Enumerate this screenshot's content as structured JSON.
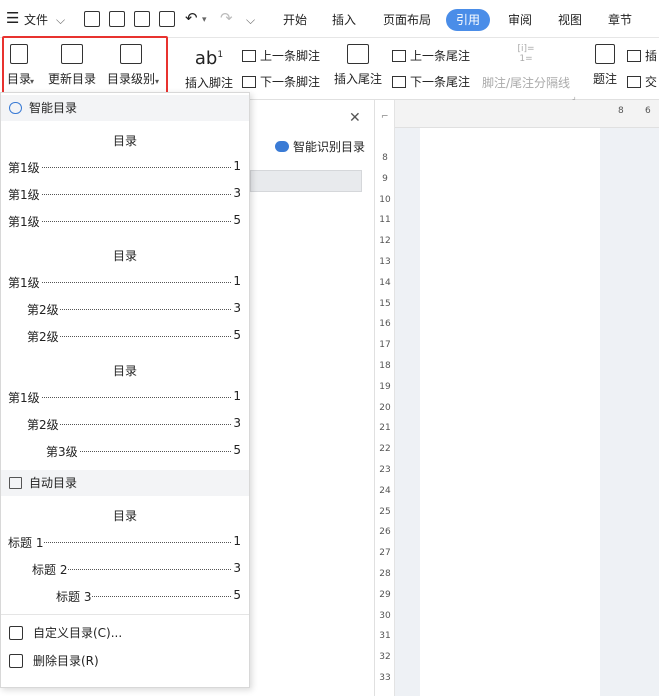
{
  "topbar": {
    "menu_label": "文件",
    "tabs": [
      "开始",
      "插入",
      "页面布局",
      "引用",
      "审阅",
      "视图",
      "章节"
    ],
    "active_tab": "引用"
  },
  "ribbon": {
    "toc_button": "目录",
    "update_toc": "更新目录",
    "toc_level": "目录级别",
    "insert_footnote": "插入脚注",
    "prev_footnote": "上一条脚注",
    "next_footnote": "下一条脚注",
    "insert_endnote": "插入尾注",
    "prev_endnote": "上一条尾注",
    "next_endnote": "下一条尾注",
    "separator": "脚注/尾注分隔线",
    "caption": "题注",
    "insert_short": "插",
    "cross_short": "交",
    "ab_superscript": "1",
    "sep_icon_text": "[i]=\n1="
  },
  "side_panel": {
    "smart_recognize": "智能识别目录"
  },
  "ruler": {
    "h_ticks": [
      "8",
      "6"
    ],
    "v_ticks": [
      "8",
      "9",
      "10",
      "11",
      "12",
      "13",
      "14",
      "15",
      "16",
      "17",
      "18",
      "19",
      "20",
      "21",
      "22",
      "23",
      "24",
      "25",
      "26",
      "27",
      "28",
      "29",
      "30",
      "31",
      "32",
      "33"
    ]
  },
  "dropdown": {
    "smart_header": "智能目录",
    "auto_header": "自动目录",
    "toc1": {
      "title": "目录",
      "lines": [
        {
          "label": "第1级",
          "page": "1"
        },
        {
          "label": "第1级",
          "page": "3"
        },
        {
          "label": "第1级",
          "page": "5"
        }
      ]
    },
    "toc2": {
      "title": "目录",
      "lines": [
        {
          "label": "第1级",
          "page": "1"
        },
        {
          "label": "第2级",
          "page": "3"
        },
        {
          "label": "第2级",
          "page": "5"
        }
      ]
    },
    "toc3": {
      "title": "目录",
      "lines": [
        {
          "label": "第1级",
          "page": "1"
        },
        {
          "label": "第2级",
          "page": "3"
        },
        {
          "label": "第3级",
          "page": "5"
        }
      ]
    },
    "auto": {
      "title": "目录",
      "lines": [
        {
          "label": "标题 1",
          "page": "1"
        },
        {
          "label": "标题 2",
          "page": "3"
        },
        {
          "label": "标题 3",
          "page": "5"
        }
      ]
    },
    "custom_toc": "自定义目录(C)...",
    "delete_toc": "删除目录(R)"
  }
}
